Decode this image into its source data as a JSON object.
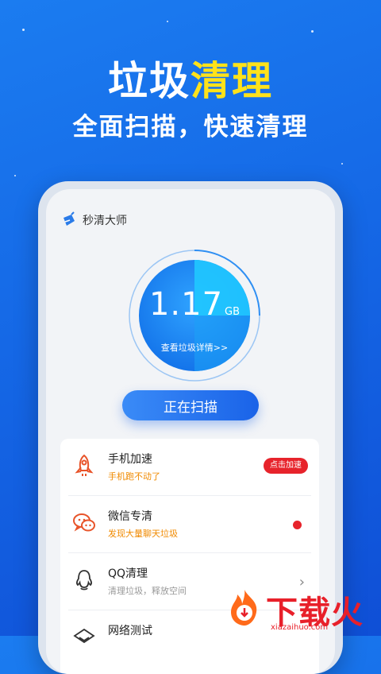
{
  "promo": {
    "headline_plain": "垃圾",
    "headline_accent": "清理",
    "subheadline": "全面扫描，快速清理"
  },
  "app": {
    "title": "秒清大师",
    "logo_icon": "broom-icon"
  },
  "gauge": {
    "value": "1.17",
    "unit": "GB",
    "details_link": "查看垃圾详情>>"
  },
  "scan_button": {
    "label": "正在扫描"
  },
  "features": [
    {
      "icon": "rocket-icon",
      "title": "手机加速",
      "subtitle": "手机跑不动了",
      "subtitle_color": "orange",
      "action": "点击加速"
    },
    {
      "icon": "wechat-icon",
      "title": "微信专清",
      "subtitle": "发现大量聊天垃圾",
      "subtitle_color": "orange",
      "indicator": "red-dot"
    },
    {
      "icon": "qq-icon",
      "title": "QQ清理",
      "subtitle": "清理垃圾，释放空间",
      "subtitle_color": "gray",
      "indicator": "chevron-right-icon"
    },
    {
      "icon": "network-icon",
      "title": "网络测试"
    }
  ],
  "watermark": {
    "brand": "下载火",
    "domain": "xiazaihuo.com"
  },
  "colors": {
    "background": "#1568e6",
    "accent_yellow": "#ffe21a",
    "alert_red": "#e7232b",
    "warning_orange": "#f08a00"
  }
}
